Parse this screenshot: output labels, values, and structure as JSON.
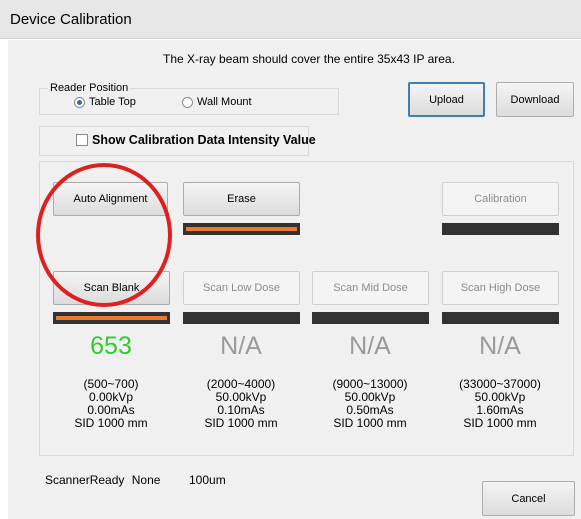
{
  "window": {
    "title": "Device Calibration"
  },
  "instruction": "The X-ray beam should cover the entire  35x43 IP area.",
  "reader_position": {
    "label": "Reader Position",
    "options": [
      {
        "label": "Table Top",
        "selected": true
      },
      {
        "label": "Wall Mount",
        "selected": false
      }
    ]
  },
  "toolbar": {
    "upload_label": "Upload",
    "download_label": "Download"
  },
  "show_intensity": {
    "label": "Show Calibration Data Intensity Value",
    "checked": false
  },
  "actions": {
    "auto_alignment_label": "Auto Alignment",
    "erase_label": "Erase",
    "calibration_label": "Calibration"
  },
  "scans": [
    {
      "button_label": "Scan Blank",
      "enabled": true,
      "value": "653",
      "value_color": "#2ecc2e",
      "range": "(500~700)",
      "kvp": "0.00kVp",
      "mas": "0.00mAs",
      "sid": "SID 1000 mm",
      "progress": 1.0
    },
    {
      "button_label": "Scan Low Dose",
      "enabled": false,
      "value": "N/A",
      "value_color": "#9a9a9a",
      "range": "(2000~4000)",
      "kvp": "50.00kVp",
      "mas": "0.10mAs",
      "sid": "SID 1000 mm",
      "progress": 0
    },
    {
      "button_label": "Scan Mid Dose",
      "enabled": false,
      "value": "N/A",
      "value_color": "#9a9a9a",
      "range": "(9000~13000)",
      "kvp": "50.00kVp",
      "mas": "0.50mAs",
      "sid": "SID 1000 mm",
      "progress": 0
    },
    {
      "button_label": "Scan  High Dose",
      "enabled": false,
      "value": "N/A",
      "value_color": "#9a9a9a",
      "range": "(33000~37000)",
      "kvp": "50.00kVp",
      "mas": "1.60mAs",
      "sid": "SID 1000 mm",
      "progress": 0
    }
  ],
  "erase_progress": 1.0,
  "calibration_progress": 0,
  "status": {
    "scanner": "ScannerReady",
    "state": "None",
    "resolution": "100um"
  },
  "footer": {
    "cancel_label": "Cancel"
  },
  "colors": {
    "progress_fill": "#f07828",
    "progress_track": "#323232",
    "annotation_circle": "#e02020"
  }
}
